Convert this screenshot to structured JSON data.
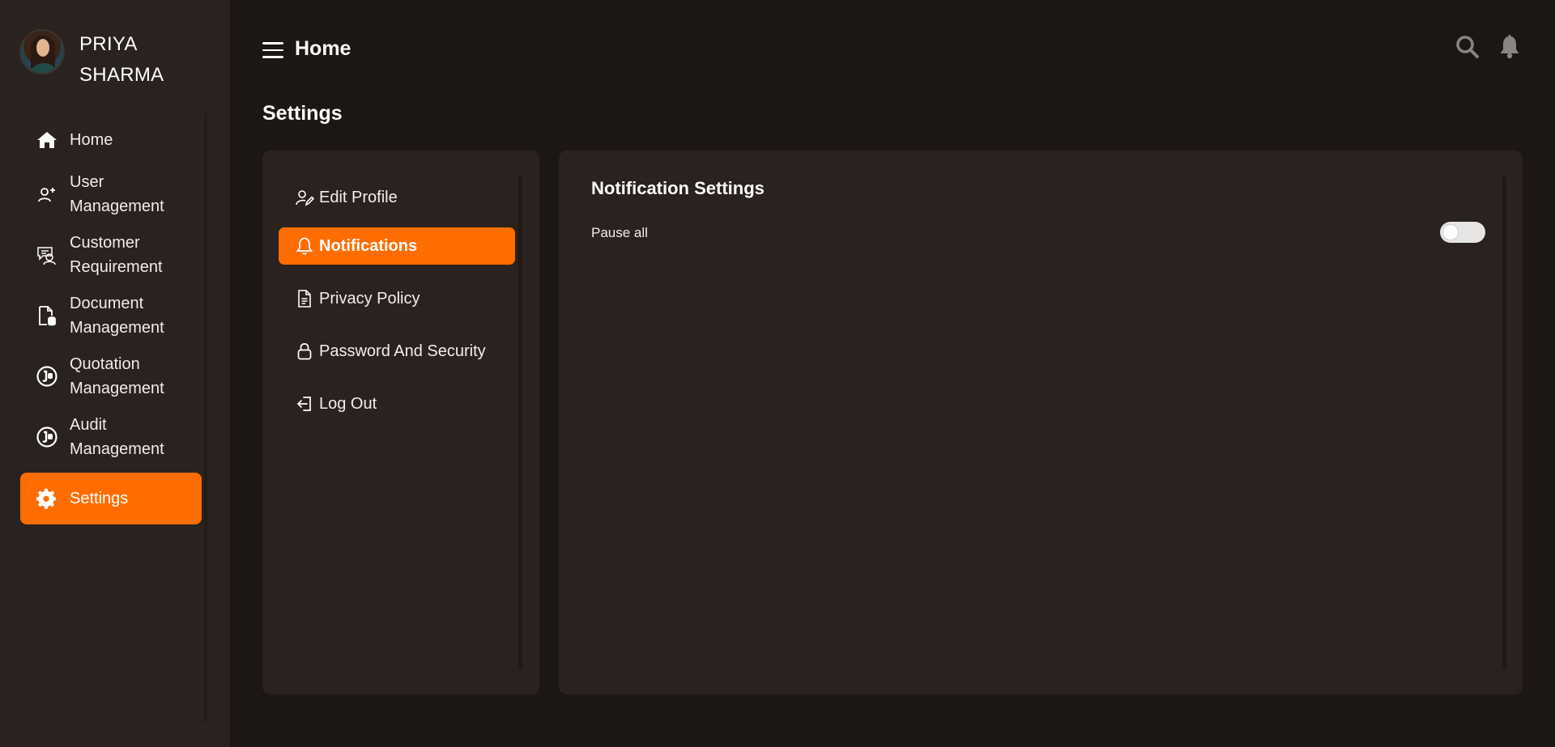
{
  "user": {
    "name_line1": "PRIYA",
    "name_line2": "SHARMA"
  },
  "sidebar": {
    "items": [
      {
        "label": "Home",
        "icon": "home-icon"
      },
      {
        "label": "User Management",
        "icon": "user-add-icon"
      },
      {
        "label": "Customer Requirement",
        "icon": "customer-chat-icon"
      },
      {
        "label": "Document Management",
        "icon": "document-database-icon"
      },
      {
        "label": "Quotation Management",
        "icon": "quotation-icon"
      },
      {
        "label": "Audit Management",
        "icon": "audit-icon"
      },
      {
        "label": "Settings",
        "icon": "gear-icon",
        "active": true
      }
    ]
  },
  "header": {
    "title": "Home"
  },
  "page": {
    "title": "Settings"
  },
  "settings_menu": {
    "items": [
      {
        "label": "Edit Profile",
        "icon": "user-edit-icon"
      },
      {
        "label": "Notifications",
        "icon": "bell-icon",
        "active": true
      },
      {
        "label": "Privacy Policy",
        "icon": "document-icon"
      },
      {
        "label": "Password And Security",
        "icon": "lock-icon"
      },
      {
        "label": "Log Out",
        "icon": "logout-icon"
      }
    ]
  },
  "notification_settings": {
    "title": "Notification Settings",
    "pause_all_label": "Pause all",
    "pause_all_enabled": false
  },
  "colors": {
    "accent": "#ff6d00",
    "background": "#1d1714",
    "panel": "#2a221e"
  }
}
